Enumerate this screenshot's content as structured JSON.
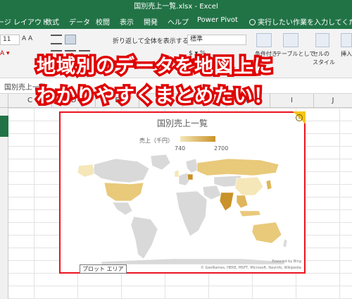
{
  "window": {
    "title": "国別売上一覧.xlsx - Excel"
  },
  "ribbon_tabs": [
    "ージ レイアウト",
    "数式",
    "データ",
    "校閲",
    "表示",
    "開発",
    "ヘルプ",
    "Power Pivot"
  ],
  "tell_me": "実行したい作業を入力してください",
  "ribbon": {
    "font_size": "11",
    "wrap_text": "折り返して全体を表示する",
    "number_format": "標準",
    "cond_format": "条件付き",
    "table_format": "テーブルとして",
    "cell_style": "セルの",
    "cell_style2": "スタイル",
    "insert": "挿入"
  },
  "formula_bar": {
    "name_box": "国別売上一覧"
  },
  "columns": [
    "C",
    "D",
    "E",
    "F",
    "G",
    "H",
    "I",
    "J"
  ],
  "banner": {
    "line1": "地域別のデータを地図上に",
    "line2": "わかりやすくまとめたい！"
  },
  "chart": {
    "title": "国別売上一覧",
    "legend_title": "売上（千円）",
    "legend_min": "740",
    "legend_max": "2700",
    "powered_by": "Powered by Bing",
    "copyright": "© GeoNames, HERE, MSFT, Microsoft, Navinfo, Wikipedia",
    "tooltip": "プロット エリア"
  },
  "colors": {
    "excel_green": "#217346",
    "banner_red": "#e00000",
    "map_low": "#f5e7b8",
    "map_high": "#c9922a",
    "map_none": "#d9d9d9"
  },
  "chart_data": {
    "type": "map",
    "title": "国別売上一覧",
    "legend": "売上（千円）",
    "range": [
      740,
      2700
    ]
  }
}
